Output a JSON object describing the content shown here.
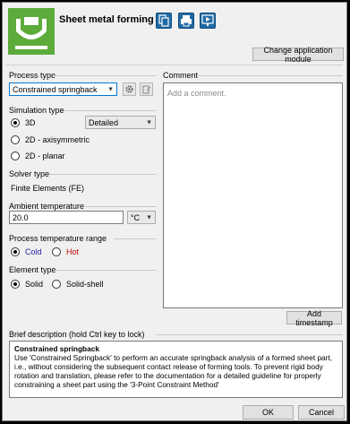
{
  "header": {
    "title": "Sheet metal forming",
    "change_module_label": "Change application module",
    "icons": [
      "copy-icon",
      "printer-icon",
      "presentation-icon"
    ],
    "logo_color": "#5dab3b"
  },
  "process_type": {
    "label": "Process type",
    "selected": "Constrained springback"
  },
  "simulation_type": {
    "label": "Simulation type",
    "options": [
      "3D",
      "2D - axisymmetric",
      "2D - planar"
    ],
    "selected_index": 0,
    "detail_selected": "Detailed"
  },
  "solver_type": {
    "label": "Solver type",
    "value": "Finite Elements (FE)"
  },
  "ambient_temperature": {
    "label": "Ambient temperature",
    "value": "20.0",
    "unit": "°C"
  },
  "process_temperature_range": {
    "label": "Process temperature range",
    "cold": "Cold",
    "hot": "Hot",
    "cold_color": "#1a1aa0",
    "hot_color": "#c00000"
  },
  "element_type": {
    "label": "Element type",
    "solid": "Solid",
    "solid_shell": "Solid-shell"
  },
  "comment": {
    "label": "Comment",
    "placeholder": "Add a comment.",
    "add_timestamp_label": "Add timestamp"
  },
  "brief_description": {
    "label": "Brief description (hold Ctrl key to lock)",
    "title": "Constrained springback",
    "text": "Use 'Constrained Springback' to perform an accurate springback analysis of a formed sheet part, i.e., without considering the subsequent contact release of forming tools. To prevent rigid body rotation and translation, please refer to the documentation for a detailed guideline for properly constraining a sheet part using the '3-Point Constraint Method'"
  },
  "footer": {
    "ok_label": "OK",
    "cancel_label": "Cancel"
  }
}
